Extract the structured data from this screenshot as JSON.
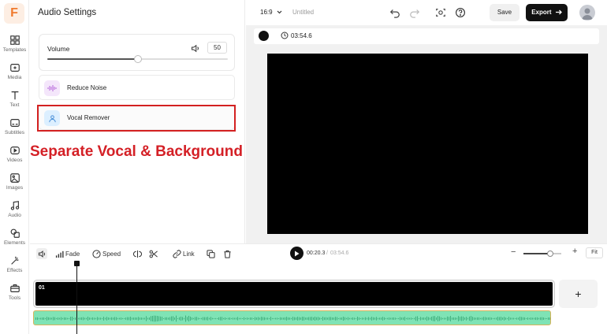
{
  "sidebar": {
    "logo": "F",
    "items": [
      {
        "label": "Templates",
        "icon": "templates-icon"
      },
      {
        "label": "Media",
        "icon": "media-icon"
      },
      {
        "label": "Text",
        "icon": "text-icon"
      },
      {
        "label": "Subtitles",
        "icon": "subtitles-icon"
      },
      {
        "label": "Videos",
        "icon": "videos-icon"
      },
      {
        "label": "Images",
        "icon": "images-icon"
      },
      {
        "label": "Audio",
        "icon": "audio-icon"
      },
      {
        "label": "Elements",
        "icon": "elements-icon"
      },
      {
        "label": "Effects",
        "icon": "effects-icon"
      },
      {
        "label": "Tools",
        "icon": "tools-icon"
      }
    ]
  },
  "panel": {
    "title": "Audio Settings",
    "volume": {
      "label": "Volume",
      "value": "50",
      "level": 0.5
    },
    "tools": [
      {
        "label": "Reduce Noise",
        "icon": "waveform-icon"
      },
      {
        "label": "Vocal Remover",
        "icon": "person-icon"
      }
    ],
    "annotation": "Separate Vocal & Background"
  },
  "topbar": {
    "ratio": "16:9",
    "title": "Untitled",
    "save": "Save",
    "export": "Export"
  },
  "preview": {
    "duration": "03:54.6"
  },
  "timeline": {
    "tools": {
      "fade": "Fade",
      "speed": "Speed",
      "link": "Link"
    },
    "current_time": "00:20.3",
    "separator": "/",
    "total_time": "03:54.6",
    "fit": "Fit",
    "zoom_level": 0.7,
    "clip_label": "01",
    "add": "+"
  },
  "colors": {
    "brand": "#f07a2e",
    "accent_red": "#d32121",
    "audio_track": "#7fe3b5",
    "noise_icon_bg": "#f4e6fb",
    "vocal_icon_bg": "#dcefff"
  }
}
